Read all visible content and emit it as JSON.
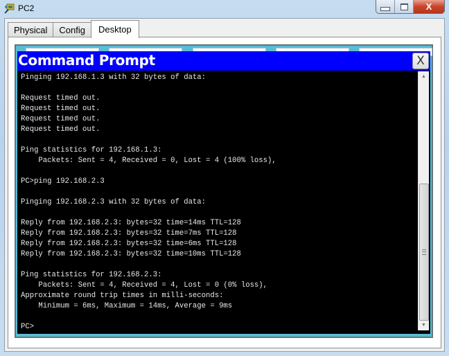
{
  "window": {
    "title": "PC2",
    "app_icon": "packet-tracer-pc-icon",
    "controls": {
      "minimize_icon": "minimize-icon",
      "maximize_icon": "maximize-icon",
      "close_icon": "close-icon",
      "close_label": "X"
    }
  },
  "tabs": [
    {
      "label": "Physical",
      "active": false
    },
    {
      "label": "Config",
      "active": false
    },
    {
      "label": "Desktop",
      "active": true
    }
  ],
  "command_prompt": {
    "title": "Command Prompt",
    "close_label": "X",
    "lines": [
      "Pinging 192.168.1.3 with 32 bytes of data:",
      "",
      "Request timed out.",
      "Request timed out.",
      "Request timed out.",
      "Request timed out.",
      "",
      "Ping statistics for 192.168.1.3:",
      "    Packets: Sent = 4, Received = 0, Lost = 4 (100% loss),",
      "",
      "PC>ping 192.168.2.3",
      "",
      "Pinging 192.168.2.3 with 32 bytes of data:",
      "",
      "Reply from 192.168.2.3: bytes=32 time=14ms TTL=128",
      "Reply from 192.168.2.3: bytes=32 time=7ms TTL=128",
      "Reply from 192.168.2.3: bytes=32 time=6ms TTL=128",
      "Reply from 192.168.2.3: bytes=32 time=10ms TTL=128",
      "",
      "Ping statistics for 192.168.2.3:",
      "    Packets: Sent = 4, Received = 4, Lost = 0 (0% loss),",
      "Approximate round trip times in milli-seconds:",
      "    Minimum = 6ms, Maximum = 14ms, Average = 9ms",
      "",
      "PC>"
    ],
    "scroll_position": "bottom"
  },
  "colors": {
    "cmd_header": "#0000ff",
    "desktop_bg": "#5bbcd5",
    "terminal_bg": "#000000",
    "terminal_fg": "#e8e8e8"
  }
}
